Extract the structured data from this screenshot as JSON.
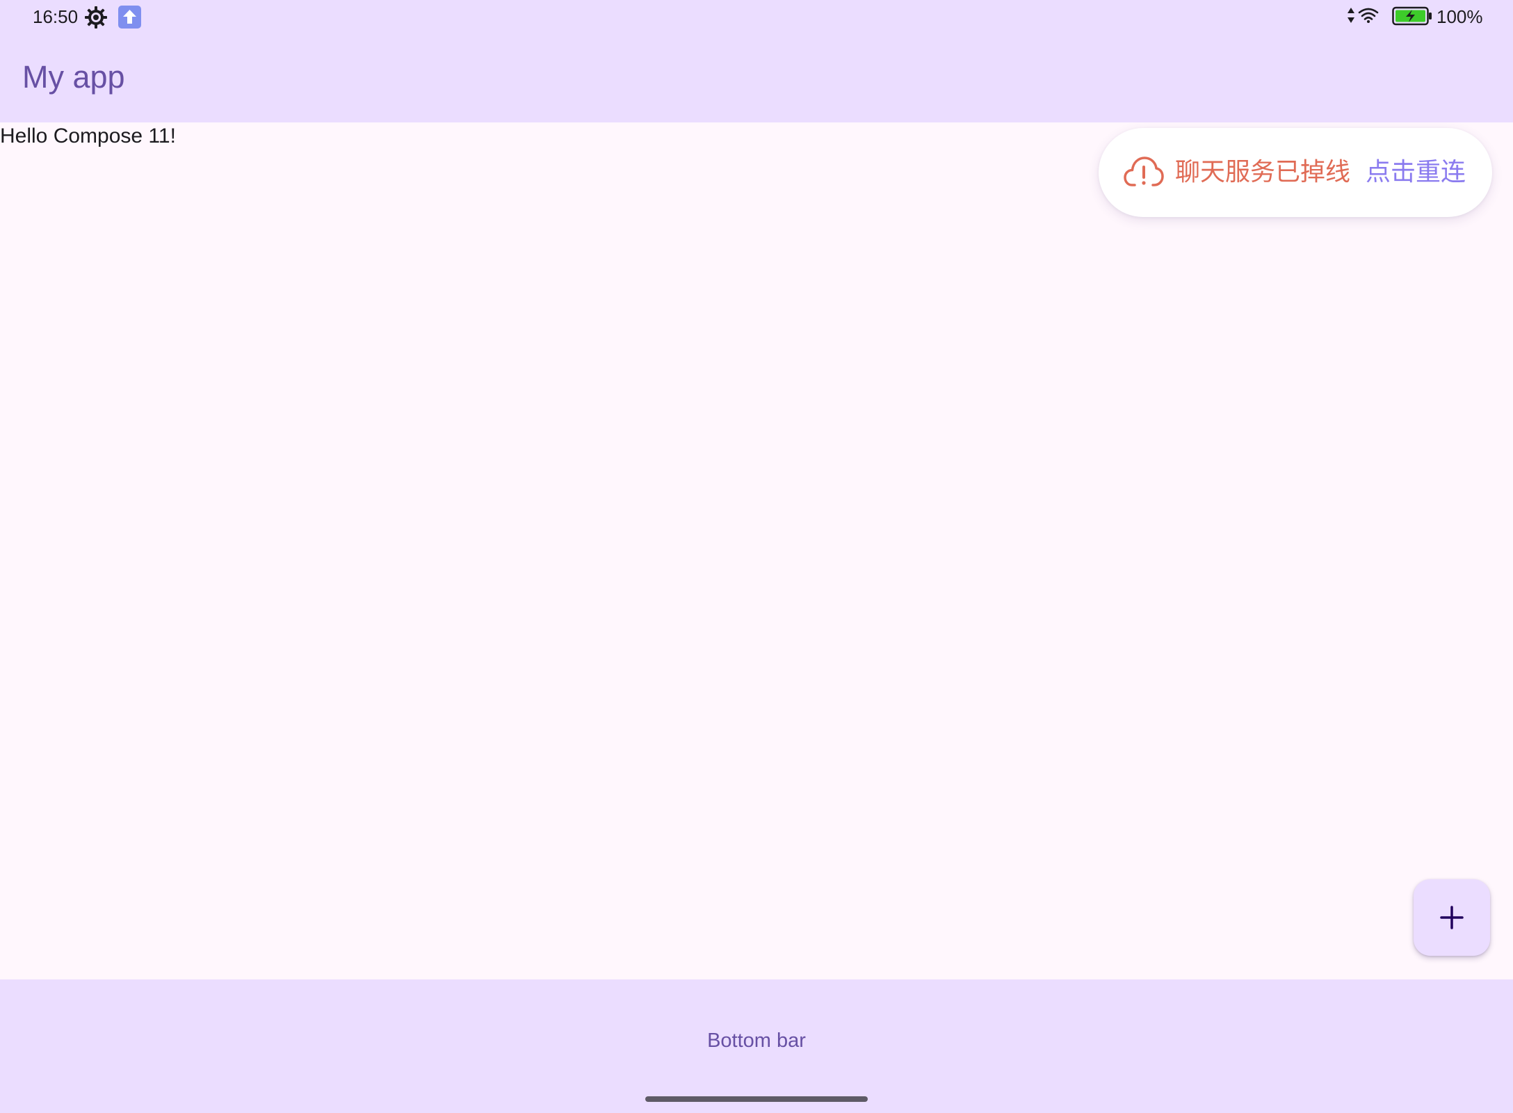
{
  "status_bar": {
    "time": "16:50",
    "battery_percent": "100%",
    "icons": [
      "settings-gear-icon",
      "upload-arrow-icon",
      "signal-arrows-icon",
      "wifi-icon",
      "battery-charging-icon"
    ]
  },
  "top_app_bar": {
    "title": "My app"
  },
  "content": {
    "greeting": "Hello Compose  11!"
  },
  "connection_banner": {
    "icon": "cloud-alert-icon",
    "message": "聊天服务已掉线",
    "action_label": "点击重连",
    "message_color": "#E06B55",
    "action_color": "#8A7BEF"
  },
  "fab": {
    "icon": "plus-icon"
  },
  "bottom_bar": {
    "label": "Bottom bar"
  },
  "colors": {
    "bar_background": "#EBDDFF",
    "page_background": "#FFF7FD",
    "title_color": "#6750A4"
  }
}
